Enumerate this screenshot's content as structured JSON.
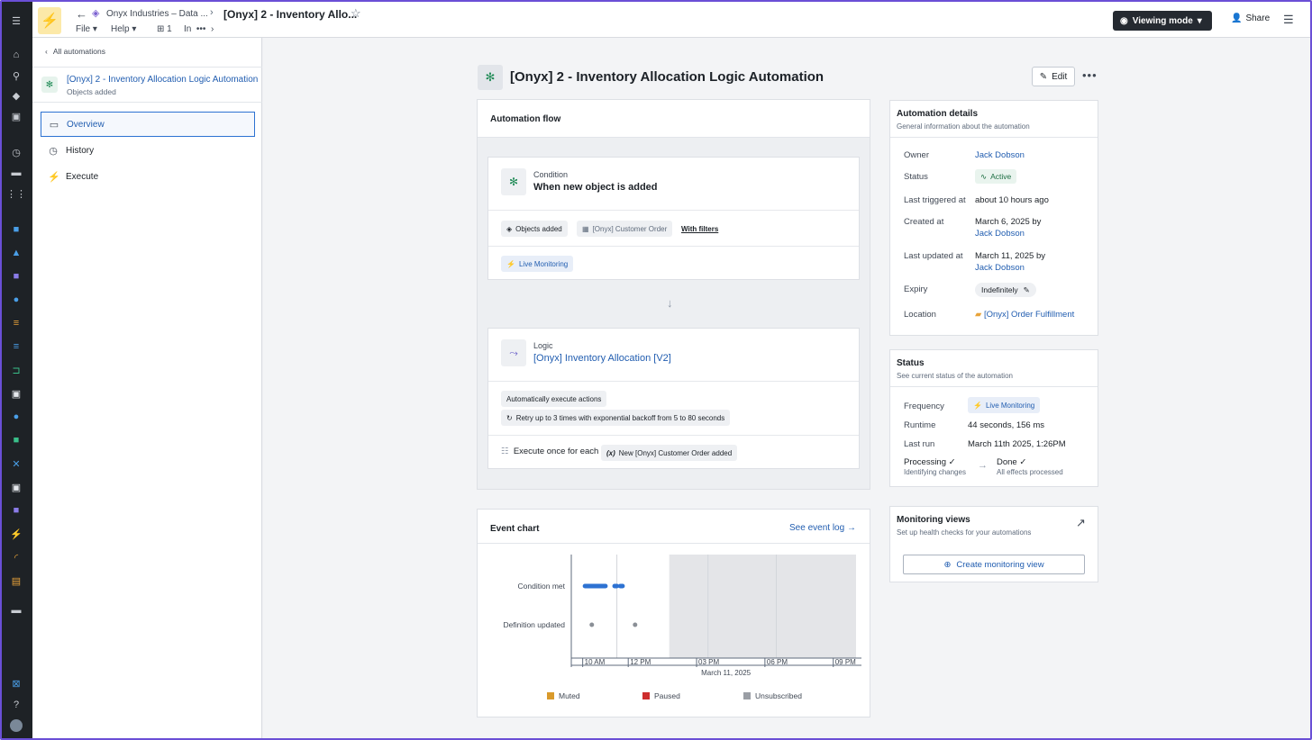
{
  "topbar": {
    "breadcrumb": "Onyx Industries – Data ...",
    "title": "[Onyx] 2 - Inventory Allo...",
    "menu_file": "File",
    "menu_help": "Help",
    "branch_count": "1",
    "in_label": "In",
    "viewing_mode": "Viewing mode",
    "share": "Share"
  },
  "sidebar": {
    "back_label": "All automations",
    "automation_name": "[Onyx] 2 - Inventory Allocation Logic Automation",
    "automation_sub": "Objects added",
    "items": [
      {
        "label": "Overview"
      },
      {
        "label": "History"
      },
      {
        "label": "Execute"
      }
    ]
  },
  "page": {
    "title": "[Onyx] 2 - Inventory Allocation Logic Automation",
    "edit": "Edit"
  },
  "flow": {
    "header": "Automation flow",
    "condition": {
      "label": "Condition",
      "title": "When new object is added",
      "tag_objects": "Objects added",
      "tag_type": "[Onyx] Customer Order",
      "with_filters": "With filters",
      "monitoring": "Live Monitoring"
    },
    "logic": {
      "label": "Logic",
      "title": "[Onyx] Inventory Allocation [V2]",
      "auto_exec": "Automatically execute actions",
      "retry": "Retry up to 3 times with exponential backoff from 5 to 80 seconds",
      "exec_once": "Execute once for each",
      "exec_tag": "New [Onyx] Customer Order added"
    }
  },
  "details": {
    "header": "Automation details",
    "sub": "General information about the automation",
    "owner_k": "Owner",
    "owner_v": "Jack Dobson",
    "status_k": "Status",
    "status_v": "Active",
    "last_trig_k": "Last triggered at",
    "last_trig_v": "about 10 hours ago",
    "created_k": "Created at",
    "created_v": "March 6, 2025 by",
    "created_by": "Jack Dobson",
    "updated_k": "Last updated at",
    "updated_v": "March 11, 2025 by",
    "updated_by": "Jack Dobson",
    "expiry_k": "Expiry",
    "expiry_v": "Indefinitely",
    "location_k": "Location",
    "location_v": "[Onyx] Order Fulfillment"
  },
  "status": {
    "header": "Status",
    "sub": "See current status of the automation",
    "freq_k": "Frequency",
    "freq_v": "Live Monitoring",
    "runtime_k": "Runtime",
    "runtime_v": "44 seconds, 156 ms",
    "lastrun_k": "Last run",
    "lastrun_v": "March 11th 2025, 1:26PM",
    "processing": "Processing",
    "processing_sub": "Identifying changes",
    "done": "Done",
    "done_sub": "All effects processed"
  },
  "monitoring": {
    "header": "Monitoring views",
    "sub": "Set up health checks for your automations",
    "create": "Create monitoring view"
  },
  "event": {
    "header": "Event chart",
    "see_log": "See event log",
    "legend_muted": "Muted",
    "legend_paused": "Paused",
    "legend_unsub": "Unsubscribed"
  },
  "chart_data": {
    "type": "scatter",
    "categories": [
      "Condition met",
      "Definition updated"
    ],
    "x_ticks": [
      "10 AM",
      "12 PM",
      "03 PM",
      "06 PM",
      "09 PM"
    ],
    "xlabel": "March 11, 2025",
    "series": [
      {
        "name": "Condition met",
        "segments": [
          [
            10.1,
            11.0
          ],
          [
            11.4,
            11.5
          ],
          [
            11.65,
            11.75
          ]
        ]
      },
      {
        "name": "Definition updated",
        "points": [
          10.4,
          12.3
        ]
      }
    ],
    "shaded_from": 13.8,
    "xlim": [
      9.5,
      22.0
    ],
    "colors": {
      "condition": "#2d72d2",
      "definition": "#8a8f96",
      "muted": "#d99a2b",
      "paused": "#cd2e2e",
      "unsubscribed": "#9a9ea5"
    }
  }
}
